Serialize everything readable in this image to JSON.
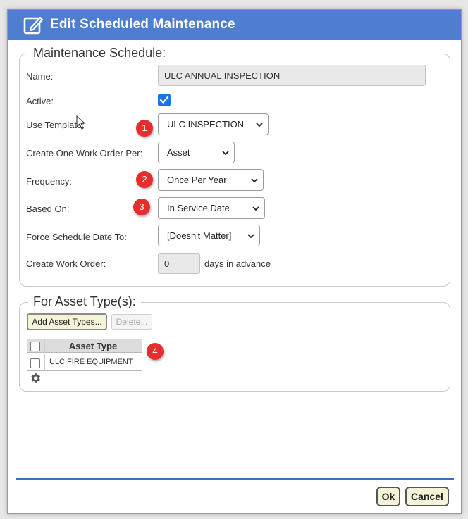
{
  "dialog": {
    "title": "Edit Scheduled Maintenance",
    "title_icon": "edit-icon",
    "accent_color": "#4f7ed0"
  },
  "schedule": {
    "legend": "Maintenance Schedule:",
    "name_label": "Name:",
    "name_value": "ULC ANNUAL INSPECTION",
    "active_label": "Active:",
    "active_checked": true,
    "template_label": "Use Template:",
    "template_value": "ULC INSPECTION",
    "work_order_per_label": "Create One Work Order Per:",
    "work_order_per_value": "Asset",
    "frequency_label": "Frequency:",
    "frequency_value": "Once Per Year",
    "based_on_label": "Based On:",
    "based_on_value": "In Service Date",
    "force_date_label": "Force Schedule Date To:",
    "force_date_value": "[Doesn't Matter]",
    "create_wo_label": "Create Work Order:",
    "create_wo_days": "0",
    "create_wo_suffix": "days in advance"
  },
  "asset_types": {
    "legend": "For Asset Type(s):",
    "add_button": "Add Asset Types...",
    "delete_button": "Delete...",
    "column_header": "Asset Type",
    "rows": [
      {
        "name": "ULC FIRE EQUIPMENT",
        "checked": false
      }
    ],
    "settings_icon": "gear-icon"
  },
  "badges": [
    "1",
    "2",
    "3",
    "4"
  ],
  "badge_color": "#e62e2e",
  "footer": {
    "ok_label": "Ok",
    "cancel_label": "Cancel"
  }
}
